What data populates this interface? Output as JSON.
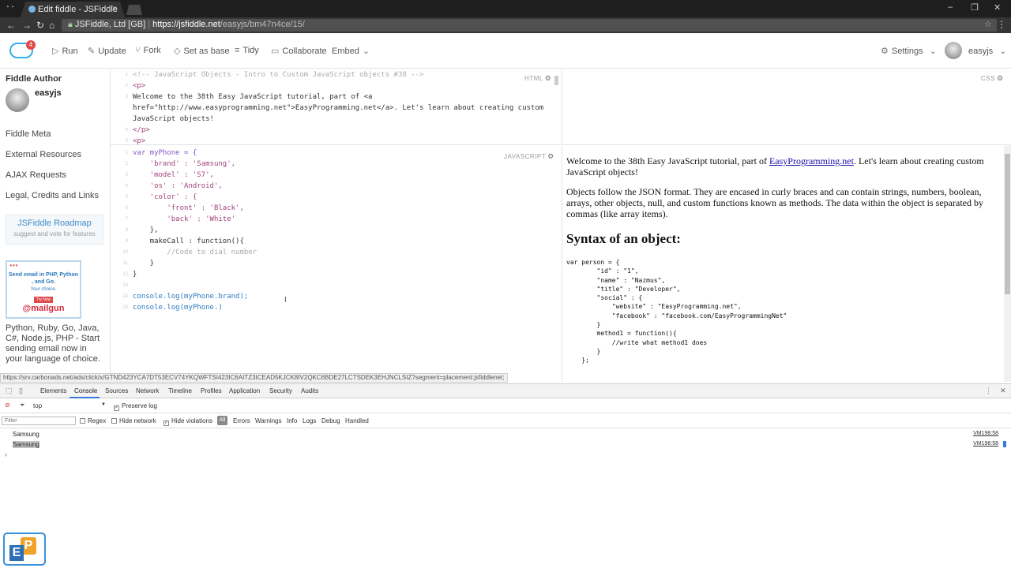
{
  "browser": {
    "tab_title": "Edit fiddle - JSFiddle",
    "tab_close": "×",
    "secure_label": "JSFiddle, Ltd [GB]",
    "url_host": "https://jsfiddle.net",
    "url_path": "/easyjs/bm47n4ce/15/"
  },
  "toolbar": {
    "badge": "4",
    "run": "Run",
    "update": "Update",
    "fork": "Fork",
    "set_base": "Set as base",
    "tidy": "Tidy",
    "collaborate": "Collaborate",
    "embed": "Embed",
    "settings": "Settings",
    "user": "easyjs"
  },
  "sidebar": {
    "author_title": "Fiddle Author",
    "author_name": "easyjs",
    "links": [
      "Fiddle Meta",
      "External Resources",
      "AJAX Requests",
      "Legal, Credits and Links"
    ],
    "roadmap_title": "JSFiddle Roadmap",
    "roadmap_sub": "suggest and vote for features",
    "ad_heading": "Send email in PHP, Python , and Go.",
    "ad_choice": "Your choice.",
    "ad_try": "Try Now",
    "ad_brand": "@mailgun",
    "ad_text": "Python, Ruby, Go, Java, C#, Node.js, PHP - Start sending email now in your language of choice."
  },
  "panes": {
    "html_label": "HTML",
    "css_label": "CSS",
    "js_label": "JAVASCRIPT"
  },
  "html_code": {
    "l1": "<!-- JavaScript Objects - Intro to Custom JavaScript objects #38 -->",
    "l2": "<p>",
    "l3a": "Welcome to the 38th Easy JavaScript tutorial, part of <a",
    "l3b": "href=\"http://www.easyprogramming.net\">EasyProgramming.net</a>. Let's learn about creating custom",
    "l3c": "JavaScript objects!",
    "l4": "</p>",
    "l5": "<p>"
  },
  "js_code": {
    "l1": "var myPhone = {",
    "l2": "    'brand' : 'Samsung',",
    "l3": "    'model' : 'S7',",
    "l4": "    'os' : 'Android',",
    "l5": "    'color' : {",
    "l6": "        'front' : 'Black',",
    "l7": "        'back' : 'White'",
    "l8": "    },",
    "l9": "    makeCall : function(){",
    "l10": "        //Code to dial number",
    "l11": "    }",
    "l12": "}",
    "l13": "",
    "l14": "console.log(myPhone.brand);",
    "l15": "console.log(myPhone.)"
  },
  "result": {
    "p1_pre": "Welcome to the 38th Easy JavaScript tutorial, part of ",
    "p1_link": "EasyProgramming.net",
    "p1_post": ". Let's learn about creating custom JavaScript objects!",
    "p2": "Objects follow the JSON format. They are encased in curly braces and can contain strings, numbers, boolean, arrays, other objects, null, and custom functions known as methods. The data within the object is separated by commas (like array items).",
    "h2": "Syntax of an object:",
    "code": "var person = {\n        \"id\" : \"1\",\n        \"name\" : \"Nazmus\",\n        \"title\" : \"Developer\",\n        \"social\" : {\n            \"website\" : \"EasyProgramming.net\",\n            \"facebook\" : \"facebook.com/EasyProgrammingNet\"\n        }\n        method1 = function(){\n            //write what method1 does\n        }\n    };"
  },
  "status_link": "https://srv.carbonads.net/ads/click/x/GTND423YCA7DT53ECV74YKQWFTSI423IC6AITZ3ICEAD5KJCK8IV2QKC6BDE27LCTSDEK3EHJNCLSIZ?segment=placement:jsfiddlenet;",
  "devtools": {
    "tabs": [
      "Elements",
      "Console",
      "Sources",
      "Network",
      "Timeline",
      "Profiles",
      "Application",
      "Security",
      "Audits"
    ],
    "context": "top",
    "preserve_log": "Preserve log",
    "filter_placeholder": "Filter",
    "regex": "Regex",
    "hide_network": "Hide network",
    "hide_violations": "Hide violations",
    "all": "All",
    "levels": [
      "Errors",
      "Warnings",
      "Info",
      "Logs",
      "Debug",
      "Handled"
    ],
    "logs": [
      {
        "text": "Samsung",
        "src": "VM198:58"
      },
      {
        "text": "Samsung",
        "src": "VM198:58"
      }
    ],
    "prompt": "›"
  },
  "colors": {
    "accent": "#3879d9",
    "brand": "#39aee9"
  }
}
